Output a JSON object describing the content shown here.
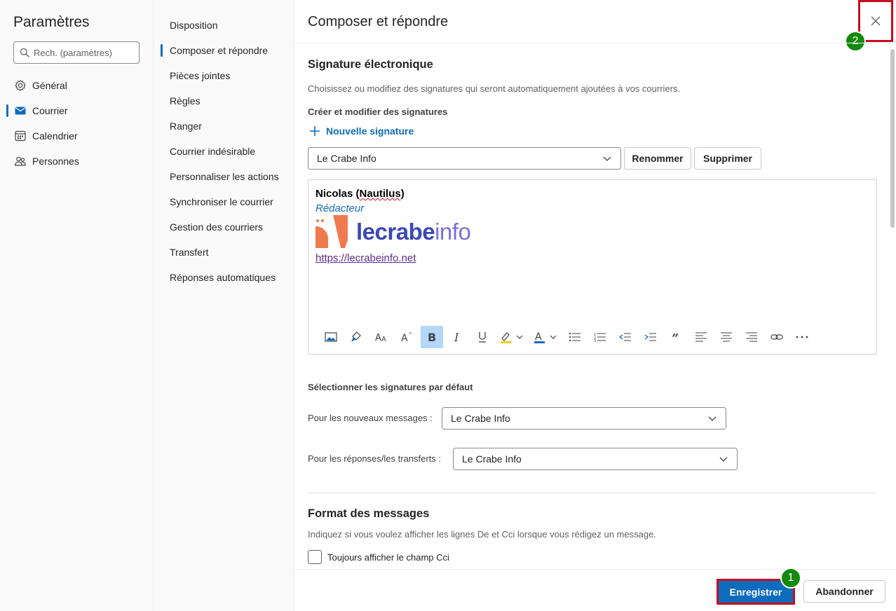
{
  "settings": {
    "title": "Paramètres",
    "search_placeholder": "Rech. (paramètres)",
    "nav": [
      {
        "label": "Général",
        "icon": "gear-icon"
      },
      {
        "label": "Courrier",
        "icon": "mail-icon",
        "active": true
      },
      {
        "label": "Calendrier",
        "icon": "calendar-icon"
      },
      {
        "label": "Personnes",
        "icon": "people-icon"
      }
    ]
  },
  "subnav": [
    {
      "label": "Disposition"
    },
    {
      "label": "Composer et répondre",
      "active": true
    },
    {
      "label": "Pièces jointes"
    },
    {
      "label": "Règles"
    },
    {
      "label": "Ranger"
    },
    {
      "label": "Courrier indésirable"
    },
    {
      "label": "Personnaliser les actions"
    },
    {
      "label": "Synchroniser le courrier"
    },
    {
      "label": "Gestion des courriers"
    },
    {
      "label": "Transfert"
    },
    {
      "label": "Réponses automatiques"
    }
  ],
  "main": {
    "title": "Composer et répondre",
    "signature": {
      "heading": "Signature électronique",
      "description": "Choisissez ou modifiez des signatures qui seront automatiquement ajoutées à vos courriers.",
      "create_label": "Créer et modifier des signatures",
      "new_signature": "Nouvelle signature",
      "selected": "Le Crabe Info",
      "rename": "Renommer",
      "delete": "Supprimer",
      "content": {
        "name_prefix": "Nicolas (",
        "name_word": "Nautilus",
        "name_suffix": ")",
        "role": "Rédacteur",
        "logo_bold": "lecrabe",
        "logo_light": "info",
        "link": "https://lecrabeinfo.net"
      }
    },
    "defaults": {
      "heading": "Sélectionner les signatures par défaut",
      "new_messages_label": "Pour les nouveaux messages :",
      "new_messages_value": "Le Crabe Info",
      "replies_label": "Pour les réponses/les transferts :",
      "replies_value": "Le Crabe Info"
    },
    "format": {
      "heading": "Format des messages",
      "description": "Indiquez si vous voulez afficher les lignes De et Cci lorsque vous rédigez un message.",
      "checkbox_label": "Toujours afficher le champ Cci"
    }
  },
  "footer": {
    "save": "Enregistrer",
    "discard": "Abandonner"
  },
  "annotations": {
    "badge_1": "1",
    "badge_2": "2",
    "highlight_color": "#c50f1f",
    "badge_color": "#138a0e"
  },
  "colors": {
    "accent": "#0f6cbd"
  }
}
